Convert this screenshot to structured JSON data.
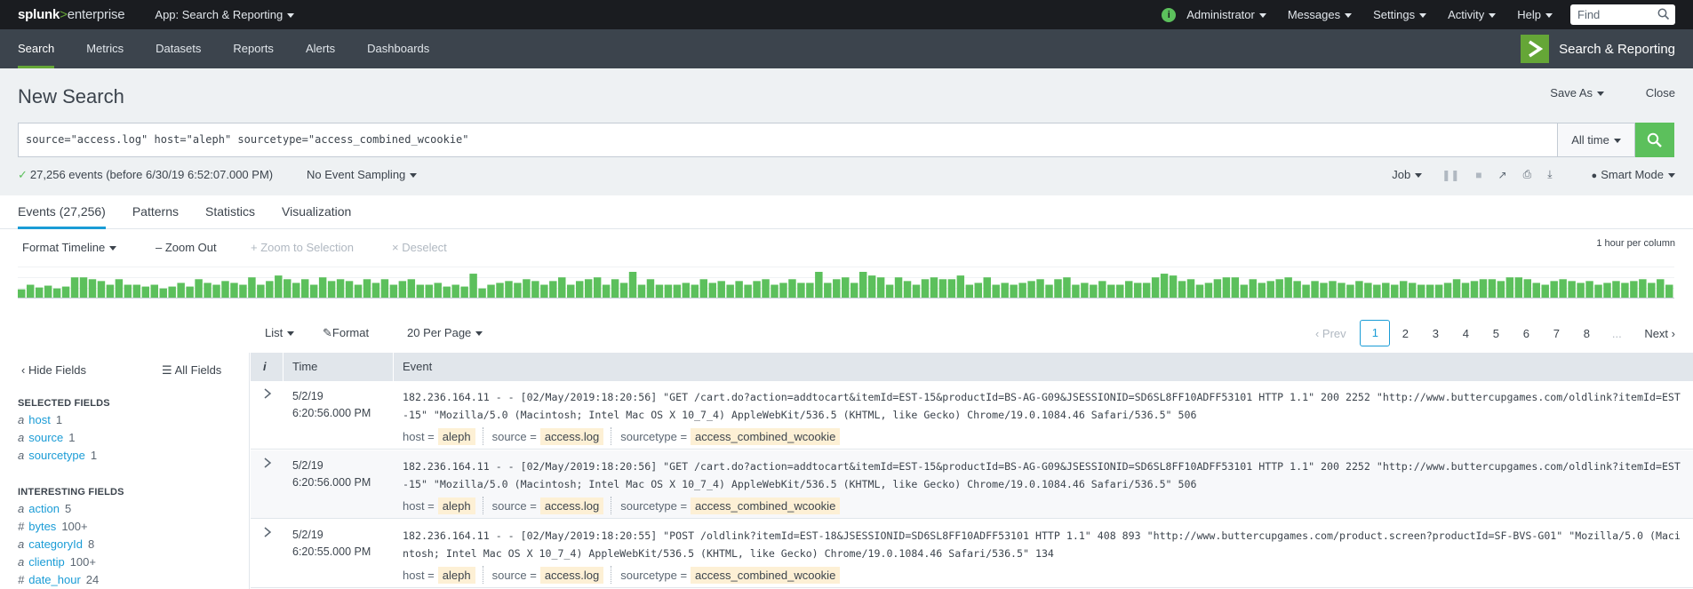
{
  "topbar": {
    "logo": {
      "splunk": "splunk",
      "gt": ">",
      "enterprise": "enterprise"
    },
    "app_menu": "App: Search & Reporting",
    "status_glyph": "i",
    "menus": [
      "Administrator",
      "Messages",
      "Settings",
      "Activity",
      "Help"
    ],
    "find_placeholder": "Find"
  },
  "nav": {
    "items": [
      "Search",
      "Metrics",
      "Datasets",
      "Reports",
      "Alerts",
      "Dashboards"
    ],
    "active": "Search",
    "app_name": "Search & Reporting"
  },
  "search": {
    "title": "New Search",
    "save_as": "Save As",
    "close": "Close",
    "query": "source=\"access.log\" host=\"aleph\" sourcetype=\"access_combined_wcookie\"",
    "time_range": "All time",
    "status": "27,256 events (before 6/30/19 6:52:07.000 PM)",
    "sampling": "No Event Sampling",
    "job": "Job",
    "mode": "Smart Mode"
  },
  "tabs": [
    "Events (27,256)",
    "Patterns",
    "Statistics",
    "Visualization"
  ],
  "timeline": {
    "format": "Format Timeline",
    "zoom_out": "Zoom Out",
    "zoom_selection": "Zoom to Selection",
    "deselect": "Deselect",
    "per_column": "1 hour per column",
    "bar_color": "#5cc05c",
    "bars": [
      9,
      14,
      11,
      13,
      10,
      12,
      22,
      22,
      20,
      18,
      14,
      20,
      14,
      14,
      12,
      14,
      10,
      12,
      16,
      12,
      20,
      16,
      14,
      18,
      16,
      14,
      22,
      14,
      18,
      24,
      20,
      16,
      20,
      14,
      22,
      18,
      20,
      18,
      14,
      20,
      16,
      20,
      14,
      18,
      20,
      14,
      14,
      16,
      12,
      14,
      12,
      26,
      10,
      14,
      16,
      18,
      16,
      20,
      18,
      14,
      18,
      22,
      14,
      18,
      20,
      22,
      14,
      20,
      16,
      28,
      14,
      20,
      14,
      14,
      14,
      16,
      14,
      20,
      16,
      18,
      14,
      18,
      14,
      18,
      20,
      14,
      16,
      20,
      16,
      16,
      28,
      16,
      20,
      22,
      16,
      28,
      24,
      22,
      14,
      22,
      18,
      14,
      20,
      22,
      20,
      20,
      24,
      14,
      16,
      22,
      14,
      16,
      14,
      16,
      18,
      20,
      14,
      20,
      22,
      14,
      16,
      14,
      18,
      14,
      14,
      18,
      16,
      16,
      22,
      26,
      24,
      18,
      20,
      14,
      16,
      20,
      22,
      22,
      14,
      20,
      16,
      18,
      20,
      22,
      18,
      14,
      18,
      16,
      18,
      16,
      14,
      18,
      16,
      14,
      16,
      14,
      18,
      16,
      14,
      14,
      14,
      16,
      20,
      16,
      18,
      20,
      20,
      18,
      22,
      22,
      20,
      16,
      14,
      18,
      20,
      18,
      16,
      18,
      14,
      16,
      18,
      16,
      18,
      20,
      16,
      20,
      14
    ],
    "bars_max": 28
  },
  "list_controls": {
    "list": "List",
    "format": "Format",
    "per_page": "20 Per Page",
    "prev": "Prev",
    "pages": [
      "1",
      "2",
      "3",
      "4",
      "5",
      "6",
      "7",
      "8"
    ],
    "ellipsis": "...",
    "current_page": "1",
    "next": "Next"
  },
  "sidebar": {
    "hide_fields": "Hide Fields",
    "all_fields": "All Fields",
    "selected_title": "SELECTED FIELDS",
    "selected": [
      {
        "type": "a",
        "name": "host",
        "count": "1"
      },
      {
        "type": "a",
        "name": "source",
        "count": "1"
      },
      {
        "type": "a",
        "name": "sourcetype",
        "count": "1"
      }
    ],
    "interesting_title": "INTERESTING FIELDS",
    "interesting": [
      {
        "type": "a",
        "name": "action",
        "count": "5"
      },
      {
        "type": "#",
        "name": "bytes",
        "count": "100+"
      },
      {
        "type": "a",
        "name": "categoryId",
        "count": "8"
      },
      {
        "type": "a",
        "name": "clientip",
        "count": "100+"
      },
      {
        "type": "#",
        "name": "date_hour",
        "count": "24"
      }
    ]
  },
  "table": {
    "info_col": "i",
    "time_col": "Time",
    "event_col": "Event",
    "rows": [
      {
        "date": "5/2/19",
        "time": "6:20:56.000 PM",
        "raw": "182.236.164.11 - - [02/May/2019:18:20:56] \"GET /cart.do?action=addtocart&itemId=EST-15&productId=BS-AG-G09&JSESSIONID=SD6SL8FF10ADFF53101 HTTP 1.1\" 200 2252 \"http://www.buttercupgames.com/oldlink?itemId=EST-15\" \"Mozilla/5.0 (Macintosh; Intel Mac OS X 10_7_4) AppleWebKit/536.5 (KHTML, like Gecko) Chrome/19.0.1084.46 Safari/536.5\" 506",
        "host": "aleph",
        "source": "access.log",
        "sourcetype": "access_combined_wcookie"
      },
      {
        "date": "5/2/19",
        "time": "6:20:56.000 PM",
        "raw": "182.236.164.11 - - [02/May/2019:18:20:56] \"GET /cart.do?action=addtocart&itemId=EST-15&productId=BS-AG-G09&JSESSIONID=SD6SL8FF10ADFF53101 HTTP 1.1\" 200 2252 \"http://www.buttercupgames.com/oldlink?itemId=EST-15\" \"Mozilla/5.0 (Macintosh; Intel Mac OS X 10_7_4) AppleWebKit/536.5 (KHTML, like Gecko) Chrome/19.0.1084.46 Safari/536.5\" 506",
        "host": "aleph",
        "source": "access.log",
        "sourcetype": "access_combined_wcookie"
      },
      {
        "date": "5/2/19",
        "time": "6:20:55.000 PM",
        "raw": "182.236.164.11 - - [02/May/2019:18:20:55] \"POST /oldlink?itemId=EST-18&JSESSIONID=SD6SL8FF10ADFF53101 HTTP 1.1\" 408 893 \"http://www.buttercupgames.com/product.screen?productId=SF-BVS-G01\" \"Mozilla/5.0 (Macintosh; Intel Mac OS X 10_7_4) AppleWebKit/536.5 (KHTML, like Gecko) Chrome/19.0.1084.46 Safari/536.5\" 134",
        "host": "aleph",
        "source": "access.log",
        "sourcetype": "access_combined_wcookie"
      }
    ],
    "field_labels": {
      "host": "host =",
      "source": "source =",
      "sourcetype": "sourcetype ="
    }
  },
  "colors": {
    "accent_green": "#65a637",
    "search_green": "#5cc05c",
    "link_blue": "#1a9cd6",
    "highlight": "#fdf0d5"
  }
}
